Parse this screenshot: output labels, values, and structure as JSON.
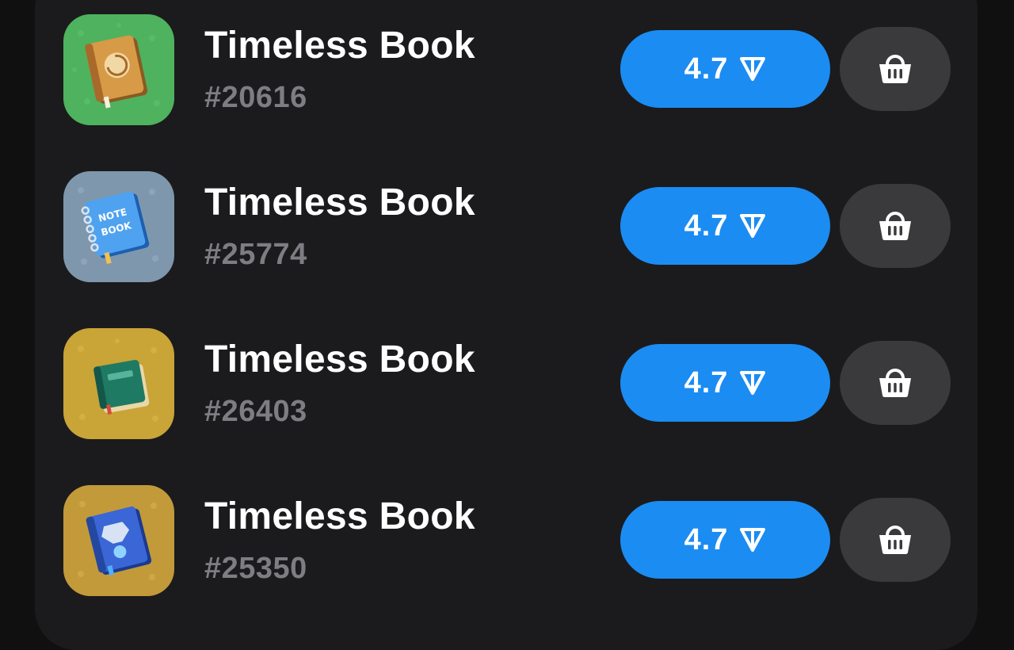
{
  "items": [
    {
      "name": "Timeless Book",
      "number": "#20616",
      "price": "4.7",
      "thumb_bg": "#4fb25e",
      "book_color": "#c98a3a"
    },
    {
      "name": "Timeless Book",
      "number": "#25774",
      "price": "4.7",
      "thumb_bg": "#7f97ad",
      "book_color": "#3f8ce0"
    },
    {
      "name": "Timeless Book",
      "number": "#26403",
      "price": "4.7",
      "thumb_bg": "#c9a437",
      "book_color": "#1f7a63"
    },
    {
      "name": "Timeless Book",
      "number": "#25350",
      "price": "4.7",
      "thumb_bg": "#c39a3a",
      "book_color": "#2f59c6"
    }
  ],
  "icons": {
    "currency": "ton-icon",
    "cart": "basket-icon"
  },
  "colors": {
    "accent": "#1b8cf2",
    "panel": "#1b1b1d",
    "cart_button": "#3a3a3d",
    "muted_text": "#7d7d82"
  }
}
